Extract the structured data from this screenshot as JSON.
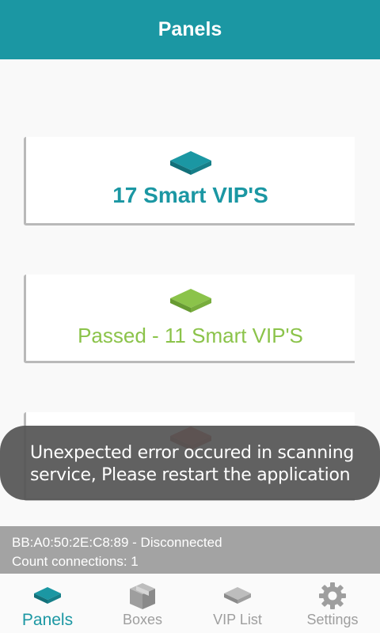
{
  "app_bar": {
    "title": "Panels"
  },
  "cards": [
    {
      "label": "17 Smart VIP'S",
      "icon": "panel-icon",
      "color": "#1b97a3"
    },
    {
      "label": "Passed - 11 Smart VIP'S",
      "icon": "panel-icon",
      "color": "#8bc34a"
    },
    {
      "label": "",
      "icon": "panel-icon",
      "color": "#c0392b"
    }
  ],
  "toast": {
    "line1": "Unexpected error occured in scanning",
    "line2": "service, Please restart the application"
  },
  "status": {
    "device": "BB:A0:50:2E:C8:89 - Disconnected",
    "connections": "Count connections: 1"
  },
  "nav": {
    "items": [
      {
        "label": "Panels",
        "icon": "panel-icon",
        "active": true
      },
      {
        "label": "Boxes",
        "icon": "box-icon",
        "active": false
      },
      {
        "label": "VIP List",
        "icon": "panel-icon",
        "active": false
      },
      {
        "label": "Settings",
        "icon": "gear-icon",
        "active": false
      }
    ]
  },
  "colors": {
    "primary": "#1b97a3",
    "success": "#8bc34a",
    "inactive": "#9e9e9e"
  }
}
